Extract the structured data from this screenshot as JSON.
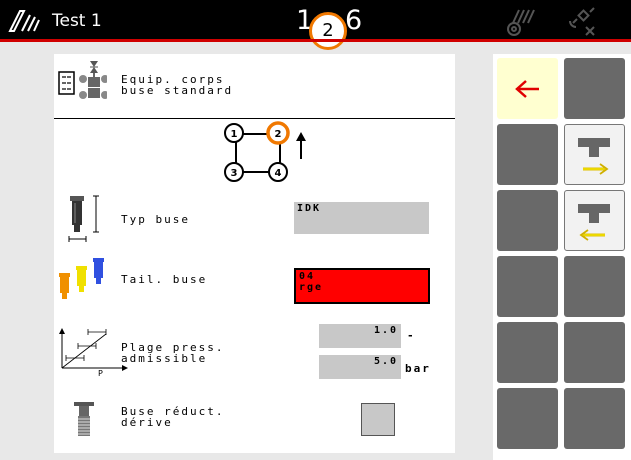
{
  "header": {
    "title": "Test 1",
    "section_left": "1",
    "section_active": "2",
    "section_right": "6"
  },
  "header_block": {
    "title_line1": "Equip. corps",
    "title_line2": "buse standard"
  },
  "nozzle_positions": {
    "labels": [
      "1",
      "2",
      "3",
      "4"
    ],
    "active": "2"
  },
  "rows": {
    "nozzle_type": {
      "label": "Typ buse",
      "value": "IDK"
    },
    "nozzle_size": {
      "label": "Tail. buse",
      "value_line1": "04",
      "value_line2": "rge"
    },
    "pressure": {
      "label_line1": "Plage press.",
      "label_line2": "admissible",
      "min": "1.0",
      "max": "5.0",
      "separator": "-",
      "unit": "bar",
      "axis_label": "P"
    },
    "drift": {
      "label_line1": "Buse réduct.",
      "label_line2": "dérive",
      "checked": false
    }
  },
  "colors": {
    "accent_orange": "#f07800",
    "warning_red": "#ff0000",
    "back_arrow_red": "#e00000",
    "arrow_yellow": "#f0e000",
    "key_gray": "#696969"
  },
  "softkeys": {
    "back_icon": "back-arrow-icon",
    "move_right_icon": "nozzle-body-right-icon",
    "move_left_icon": "nozzle-body-left-icon"
  }
}
